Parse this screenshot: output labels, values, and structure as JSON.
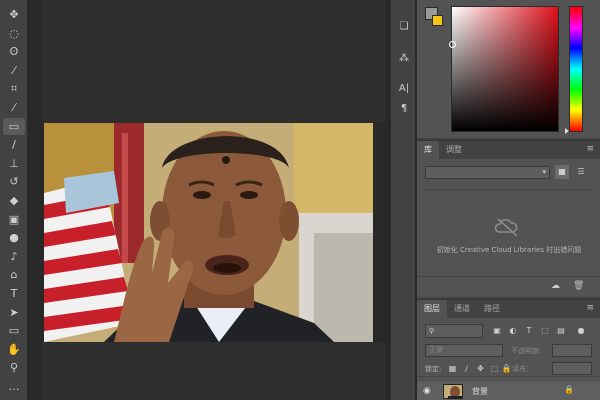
{
  "toolbar": {
    "tools": [
      {
        "name": "move-tool",
        "icon": "move-icon",
        "glyph": "✥"
      },
      {
        "name": "marquee-tool",
        "icon": "ellipse-marquee-icon",
        "glyph": "◌"
      },
      {
        "name": "lasso-tool",
        "icon": "lasso-icon",
        "glyph": "ʘ"
      },
      {
        "name": "magic-wand-tool",
        "icon": "magic-wand-icon",
        "glyph": "⁄"
      },
      {
        "name": "crop-tool",
        "icon": "crop-icon",
        "glyph": "⌗"
      },
      {
        "name": "eyedropper-tool",
        "icon": "eyedropper-icon",
        "glyph": "⁄"
      },
      {
        "name": "healing-brush-tool",
        "icon": "bandage-icon",
        "glyph": "▭",
        "active": true
      },
      {
        "name": "brush-tool",
        "icon": "brush-icon",
        "glyph": "∕"
      },
      {
        "name": "clone-stamp-tool",
        "icon": "stamp-icon",
        "glyph": "⊥"
      },
      {
        "name": "history-brush-tool",
        "icon": "history-brush-icon",
        "glyph": "↺"
      },
      {
        "name": "eraser-tool",
        "icon": "eraser-icon",
        "glyph": "◆"
      },
      {
        "name": "gradient-tool",
        "icon": "gradient-icon",
        "glyph": "▣"
      },
      {
        "name": "blur-tool",
        "icon": "drop-icon",
        "glyph": "●"
      },
      {
        "name": "dodge-tool",
        "icon": "dodge-icon",
        "glyph": "♪"
      },
      {
        "name": "pen-tool",
        "icon": "pen-icon",
        "glyph": "⌂"
      },
      {
        "name": "type-tool",
        "icon": "type-icon",
        "glyph": "T"
      },
      {
        "name": "path-selection-tool",
        "icon": "arrow-icon",
        "glyph": "➤"
      },
      {
        "name": "rectangle-tool",
        "icon": "rectangle-icon",
        "glyph": "▭"
      },
      {
        "name": "hand-tool",
        "icon": "hand-icon",
        "glyph": "✋"
      },
      {
        "name": "zoom-tool",
        "icon": "magnifier-icon",
        "glyph": "⚲"
      },
      {
        "name": "edit-toolbar",
        "icon": "more-icon",
        "glyph": "…"
      }
    ]
  },
  "dock": {
    "buttons": [
      {
        "name": "history-panel-button",
        "icon": "history-icon",
        "glyph": "❏"
      },
      {
        "name": "brush-settings-button",
        "icon": "brush-settings-icon",
        "glyph": "⁂"
      },
      {
        "name": "character-panel-button",
        "icon": "character-icon",
        "glyph": "A|"
      },
      {
        "name": "paragraph-panel-button",
        "icon": "paragraph-icon",
        "glyph": "¶"
      }
    ]
  },
  "colors": {
    "foreground": "#9a9a9a",
    "background": "#f6c413",
    "picker_hue": "#e0101a"
  },
  "libraries_panel": {
    "tabs": [
      "库",
      "调整"
    ],
    "active_tab": 0,
    "menu_glyph": "≡",
    "message": "初始化 Creative Cloud Libraries 时出错问题"
  },
  "layers_panel": {
    "tabs": [
      "图层",
      "通道",
      "路径"
    ],
    "active_tab": 0,
    "menu_glyph": "≡",
    "filter_kind": "",
    "blend_mode": "正常",
    "opacity_label": "不透明度:",
    "opacity_value": "",
    "lock_label": "锁定:",
    "fill_label": "填充:",
    "fill_value": "",
    "layer": {
      "name": "背景",
      "visible": true,
      "locked": true
    }
  }
}
